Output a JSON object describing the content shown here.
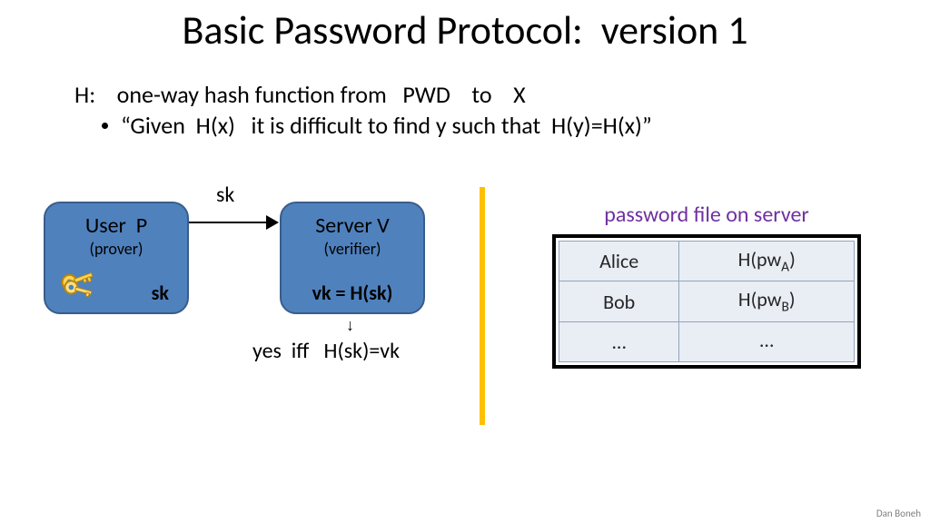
{
  "title": "Basic Password Protocol:  version 1",
  "def_line": "H:    one-way hash function from   PWD    to    X",
  "bullet": "“Given  H(x)   it is difficult to find y such that  H(y)=H(x)”",
  "user_box": {
    "title": "User  P",
    "sub": "(prover)",
    "bottom": "sk"
  },
  "server_box": {
    "title": "Server V",
    "sub": "(verifier)",
    "bottom": "vk = H(sk)"
  },
  "arrow_label": "sk",
  "yes_iff": "yes  iff   H(sk)=vk",
  "file_caption": "password file on server",
  "table": {
    "rows": [
      {
        "name": "Alice",
        "hash_prefix": "H(pw",
        "hash_sub": "A",
        "hash_suffix": ")"
      },
      {
        "name": "Bob",
        "hash_prefix": "H(pw",
        "hash_sub": "B",
        "hash_suffix": ")"
      },
      {
        "name": "…",
        "hash_prefix": "…",
        "hash_sub": "",
        "hash_suffix": ""
      }
    ]
  },
  "attribution": "Dan Boneh"
}
